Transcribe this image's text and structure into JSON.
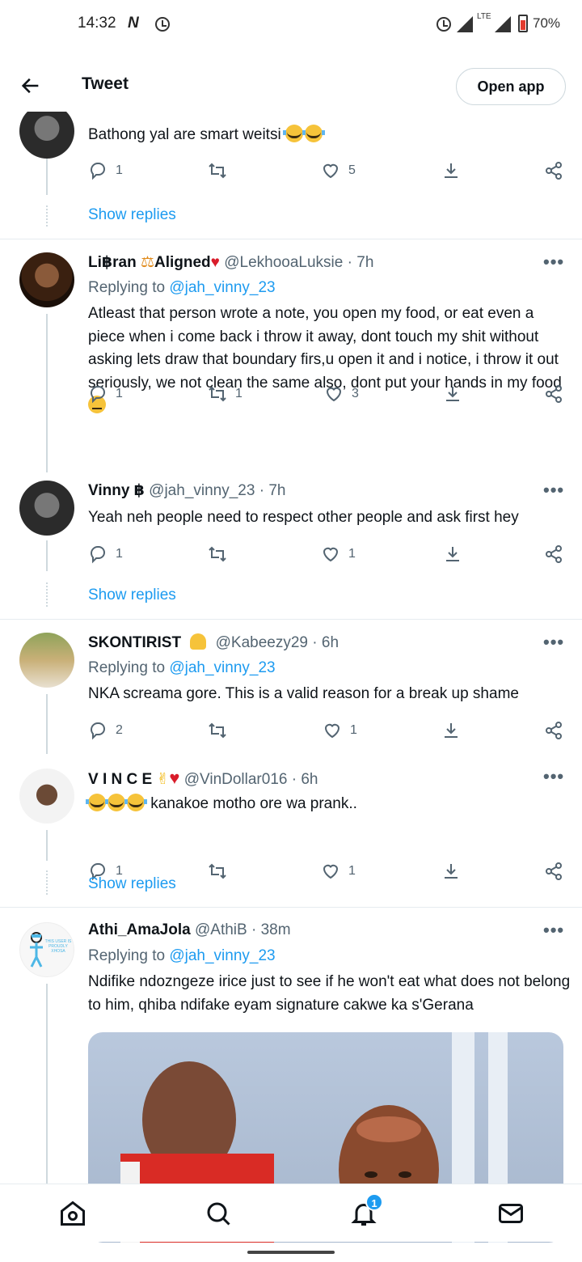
{
  "status_bar": {
    "time": "14:32",
    "network_icon": "N",
    "network_type": "LTE",
    "battery": "70%"
  },
  "header": {
    "title": "Tweet",
    "open_app": "Open app"
  },
  "tweets": [
    {
      "text": "Bathong yal are smart weitsi",
      "reply_count": "1",
      "retweet_count": "",
      "like_count": "5",
      "show_replies": "Show replies"
    },
    {
      "name": "Li฿ranAligned",
      "name_part1": "Li฿ran",
      "name_part2": "Aligned",
      "handle": "@LekhooaLuksie",
      "time": "· 7h",
      "replying_prefix": "Replying to",
      "replying_handle": "@jah_vinny_23",
      "text": "Atleast that person wrote a note, you open my food, or eat even a piece when i come back i throw it away, dont touch my shit without asking lets draw that boundary firs,u open it and i notice, i throw it out seriously, we not clean the same also, dont put your hands in my food",
      "reply_count": "1",
      "retweet_count": "1",
      "like_count": "3"
    },
    {
      "name": "Vinny ฿",
      "handle": "@jah_vinny_23",
      "time": "· 7h",
      "text": "Yeah neh people need to respect other people and ask first hey",
      "reply_count": "1",
      "retweet_count": "",
      "like_count": "1",
      "show_replies": "Show replies"
    },
    {
      "name": "SKONTIRIST",
      "handle": "@Kabeezy29",
      "time": "· 6h",
      "replying_prefix": "Replying to",
      "replying_handle": "@jah_vinny_23",
      "text": "NKA screama gore. This is a valid reason for a break up shame",
      "reply_count": "2",
      "retweet_count": "",
      "like_count": "1"
    },
    {
      "name": "V I N C E",
      "handle": "@VinDollar016",
      "time": "· 6h",
      "text": "kanakoe  motho ore  wa prank..",
      "reply_count": "1",
      "retweet_count": "",
      "like_count": "1",
      "show_replies": "Show replies"
    },
    {
      "name": "Athi_AmaJola",
      "handle": "@AthiB",
      "time": "· 38m",
      "replying_prefix": "Replying to",
      "replying_handle": "@jah_vinny_23",
      "text": "Ndifike ndozngeze irice just to see if he won't eat what does not belong to him, qhiba ndifake eyam signature cakwe ka s'Gerana",
      "avatar_text": "THIS USER IS PROUDLY XHOSA"
    }
  ],
  "bottom_nav": {
    "notification_badge": "1"
  },
  "colors": {
    "accent": "#1d9bf0",
    "secondary_text": "#536471",
    "divider": "#e6ecf0"
  }
}
